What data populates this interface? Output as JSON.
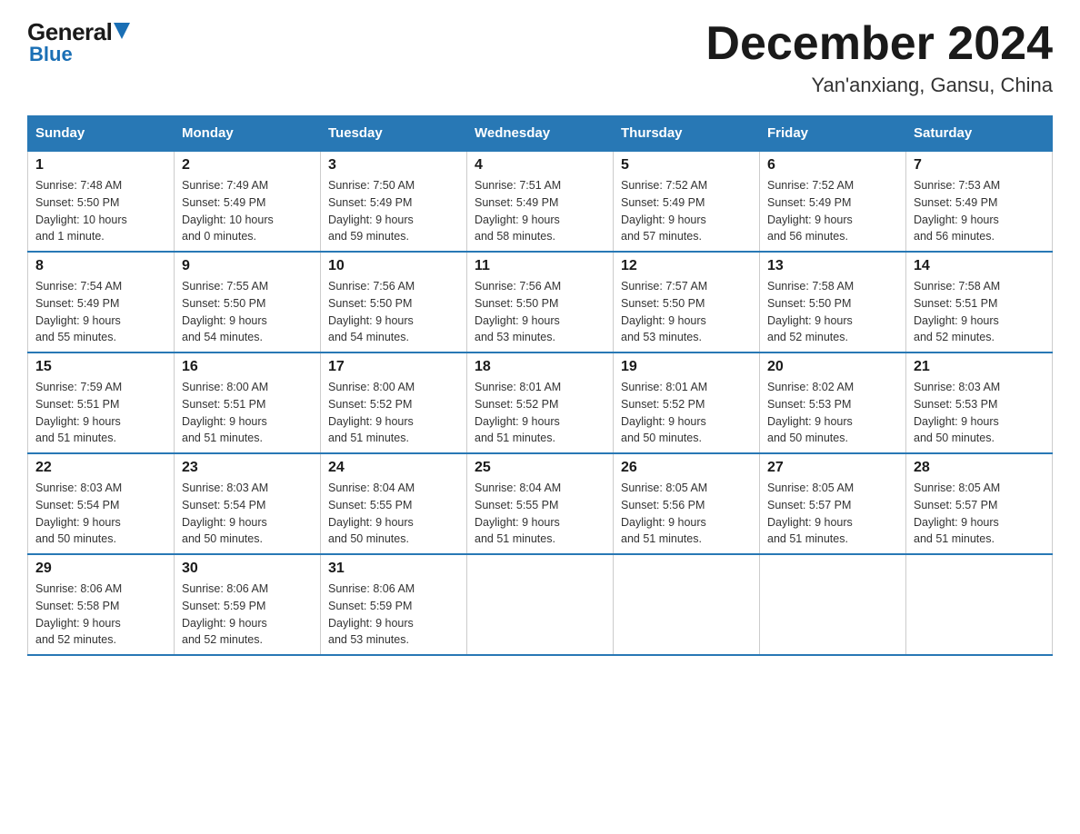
{
  "logo": {
    "general": "General",
    "blue": "Blue"
  },
  "title": "December 2024",
  "subtitle": "Yan'anxiang, Gansu, China",
  "days_of_week": [
    "Sunday",
    "Monday",
    "Tuesday",
    "Wednesday",
    "Thursday",
    "Friday",
    "Saturday"
  ],
  "weeks": [
    [
      {
        "day": "1",
        "sunrise": "7:48 AM",
        "sunset": "5:50 PM",
        "daylight": "10 hours and 1 minute."
      },
      {
        "day": "2",
        "sunrise": "7:49 AM",
        "sunset": "5:49 PM",
        "daylight": "10 hours and 0 minutes."
      },
      {
        "day": "3",
        "sunrise": "7:50 AM",
        "sunset": "5:49 PM",
        "daylight": "9 hours and 59 minutes."
      },
      {
        "day": "4",
        "sunrise": "7:51 AM",
        "sunset": "5:49 PM",
        "daylight": "9 hours and 58 minutes."
      },
      {
        "day": "5",
        "sunrise": "7:52 AM",
        "sunset": "5:49 PM",
        "daylight": "9 hours and 57 minutes."
      },
      {
        "day": "6",
        "sunrise": "7:52 AM",
        "sunset": "5:49 PM",
        "daylight": "9 hours and 56 minutes."
      },
      {
        "day": "7",
        "sunrise": "7:53 AM",
        "sunset": "5:49 PM",
        "daylight": "9 hours and 56 minutes."
      }
    ],
    [
      {
        "day": "8",
        "sunrise": "7:54 AM",
        "sunset": "5:49 PM",
        "daylight": "9 hours and 55 minutes."
      },
      {
        "day": "9",
        "sunrise": "7:55 AM",
        "sunset": "5:50 PM",
        "daylight": "9 hours and 54 minutes."
      },
      {
        "day": "10",
        "sunrise": "7:56 AM",
        "sunset": "5:50 PM",
        "daylight": "9 hours and 54 minutes."
      },
      {
        "day": "11",
        "sunrise": "7:56 AM",
        "sunset": "5:50 PM",
        "daylight": "9 hours and 53 minutes."
      },
      {
        "day": "12",
        "sunrise": "7:57 AM",
        "sunset": "5:50 PM",
        "daylight": "9 hours and 53 minutes."
      },
      {
        "day": "13",
        "sunrise": "7:58 AM",
        "sunset": "5:50 PM",
        "daylight": "9 hours and 52 minutes."
      },
      {
        "day": "14",
        "sunrise": "7:58 AM",
        "sunset": "5:51 PM",
        "daylight": "9 hours and 52 minutes."
      }
    ],
    [
      {
        "day": "15",
        "sunrise": "7:59 AM",
        "sunset": "5:51 PM",
        "daylight": "9 hours and 51 minutes."
      },
      {
        "day": "16",
        "sunrise": "8:00 AM",
        "sunset": "5:51 PM",
        "daylight": "9 hours and 51 minutes."
      },
      {
        "day": "17",
        "sunrise": "8:00 AM",
        "sunset": "5:52 PM",
        "daylight": "9 hours and 51 minutes."
      },
      {
        "day": "18",
        "sunrise": "8:01 AM",
        "sunset": "5:52 PM",
        "daylight": "9 hours and 51 minutes."
      },
      {
        "day": "19",
        "sunrise": "8:01 AM",
        "sunset": "5:52 PM",
        "daylight": "9 hours and 50 minutes."
      },
      {
        "day": "20",
        "sunrise": "8:02 AM",
        "sunset": "5:53 PM",
        "daylight": "9 hours and 50 minutes."
      },
      {
        "day": "21",
        "sunrise": "8:03 AM",
        "sunset": "5:53 PM",
        "daylight": "9 hours and 50 minutes."
      }
    ],
    [
      {
        "day": "22",
        "sunrise": "8:03 AM",
        "sunset": "5:54 PM",
        "daylight": "9 hours and 50 minutes."
      },
      {
        "day": "23",
        "sunrise": "8:03 AM",
        "sunset": "5:54 PM",
        "daylight": "9 hours and 50 minutes."
      },
      {
        "day": "24",
        "sunrise": "8:04 AM",
        "sunset": "5:55 PM",
        "daylight": "9 hours and 50 minutes."
      },
      {
        "day": "25",
        "sunrise": "8:04 AM",
        "sunset": "5:55 PM",
        "daylight": "9 hours and 51 minutes."
      },
      {
        "day": "26",
        "sunrise": "8:05 AM",
        "sunset": "5:56 PM",
        "daylight": "9 hours and 51 minutes."
      },
      {
        "day": "27",
        "sunrise": "8:05 AM",
        "sunset": "5:57 PM",
        "daylight": "9 hours and 51 minutes."
      },
      {
        "day": "28",
        "sunrise": "8:05 AM",
        "sunset": "5:57 PM",
        "daylight": "9 hours and 51 minutes."
      }
    ],
    [
      {
        "day": "29",
        "sunrise": "8:06 AM",
        "sunset": "5:58 PM",
        "daylight": "9 hours and 52 minutes."
      },
      {
        "day": "30",
        "sunrise": "8:06 AM",
        "sunset": "5:59 PM",
        "daylight": "9 hours and 52 minutes."
      },
      {
        "day": "31",
        "sunrise": "8:06 AM",
        "sunset": "5:59 PM",
        "daylight": "9 hours and 53 minutes."
      },
      null,
      null,
      null,
      null
    ]
  ],
  "labels": {
    "sunrise": "Sunrise:",
    "sunset": "Sunset:",
    "daylight": "Daylight:"
  }
}
